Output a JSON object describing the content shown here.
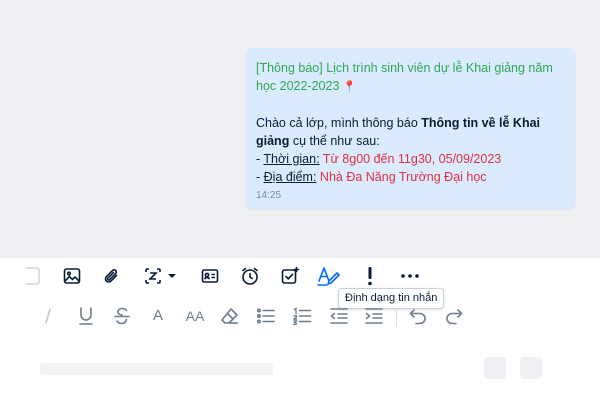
{
  "message": {
    "title": "[Thông báo] Lịch trình sinh viên dự lễ Khai giảng năm học 2022-2023",
    "pin_icon": "pushpin-icon",
    "greeting_prefix": "Chào cả lớp, mình thông báo ",
    "greeting_bold": "Thông tin về lễ Khai giảng",
    "greeting_suffix": " cụ thể như sau:",
    "time_dash": "- ",
    "time_label": "Thời gian:",
    "time_value": " Từ 8g00 đến 11g30, 05/09/2023",
    "place_dash": "- ",
    "place_label": "Địa điểm:",
    "place_value": " Nhà Đa Năng Trường Đại học",
    "timestamp": "14:25"
  },
  "toolbar": {
    "items": [
      {
        "name": "sticker-icon"
      },
      {
        "name": "image-icon"
      },
      {
        "name": "attachment-icon"
      },
      {
        "name": "screenshot-icon"
      },
      {
        "name": "contact-card-icon"
      },
      {
        "name": "reminder-clock-icon"
      },
      {
        "name": "task-icon"
      },
      {
        "name": "text-format-icon"
      },
      {
        "name": "urgent-icon"
      },
      {
        "name": "more-icon"
      }
    ],
    "tooltip": "Định dạng tin nhắn"
  },
  "format_bar": {
    "font_size_label": "A",
    "font_case_label": "AA"
  },
  "colors": {
    "bubble": "#dbebff",
    "title_green": "#2fa84f",
    "highlight_red": "#e0303c",
    "icon_dark": "#081c36",
    "active_blue": "#0068ff"
  }
}
